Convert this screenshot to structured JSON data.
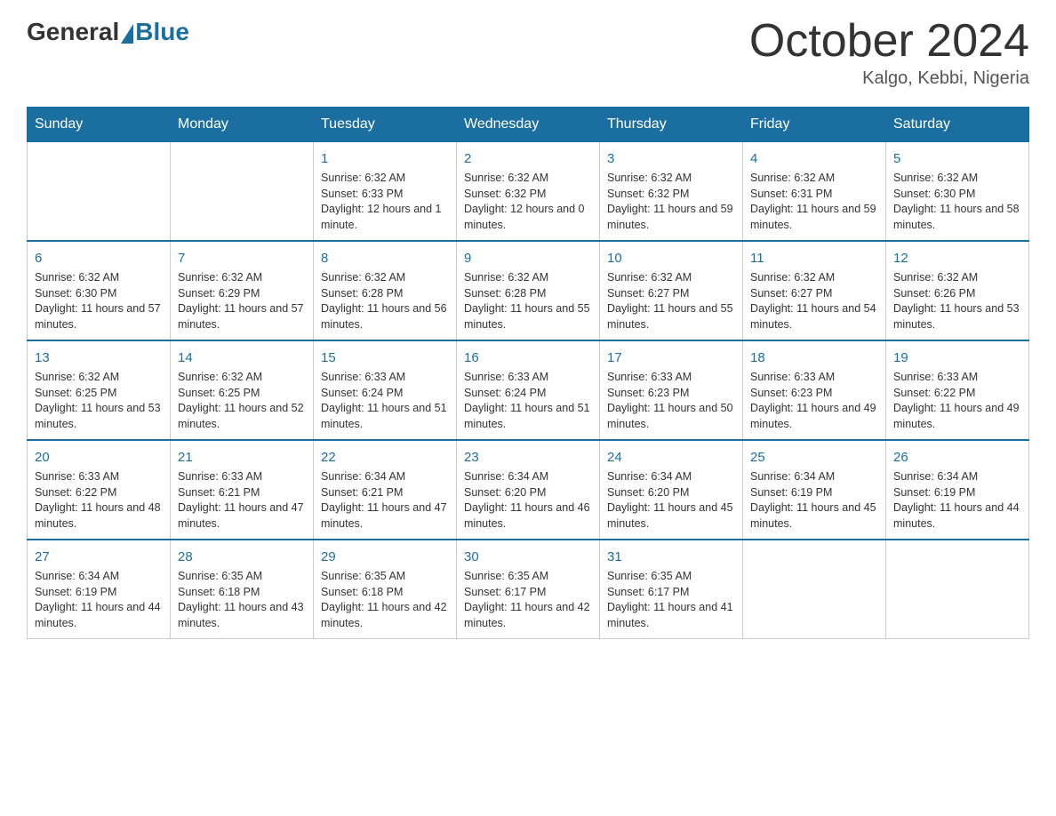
{
  "header": {
    "logo_general": "General",
    "logo_blue": "Blue",
    "month_title": "October 2024",
    "location": "Kalgo, Kebbi, Nigeria"
  },
  "weekdays": [
    "Sunday",
    "Monday",
    "Tuesday",
    "Wednesday",
    "Thursday",
    "Friday",
    "Saturday"
  ],
  "weeks": [
    [
      {
        "day": "",
        "sunrise": "",
        "sunset": "",
        "daylight": ""
      },
      {
        "day": "",
        "sunrise": "",
        "sunset": "",
        "daylight": ""
      },
      {
        "day": "1",
        "sunrise": "Sunrise: 6:32 AM",
        "sunset": "Sunset: 6:33 PM",
        "daylight": "Daylight: 12 hours and 1 minute."
      },
      {
        "day": "2",
        "sunrise": "Sunrise: 6:32 AM",
        "sunset": "Sunset: 6:32 PM",
        "daylight": "Daylight: 12 hours and 0 minutes."
      },
      {
        "day": "3",
        "sunrise": "Sunrise: 6:32 AM",
        "sunset": "Sunset: 6:32 PM",
        "daylight": "Daylight: 11 hours and 59 minutes."
      },
      {
        "day": "4",
        "sunrise": "Sunrise: 6:32 AM",
        "sunset": "Sunset: 6:31 PM",
        "daylight": "Daylight: 11 hours and 59 minutes."
      },
      {
        "day": "5",
        "sunrise": "Sunrise: 6:32 AM",
        "sunset": "Sunset: 6:30 PM",
        "daylight": "Daylight: 11 hours and 58 minutes."
      }
    ],
    [
      {
        "day": "6",
        "sunrise": "Sunrise: 6:32 AM",
        "sunset": "Sunset: 6:30 PM",
        "daylight": "Daylight: 11 hours and 57 minutes."
      },
      {
        "day": "7",
        "sunrise": "Sunrise: 6:32 AM",
        "sunset": "Sunset: 6:29 PM",
        "daylight": "Daylight: 11 hours and 57 minutes."
      },
      {
        "day": "8",
        "sunrise": "Sunrise: 6:32 AM",
        "sunset": "Sunset: 6:28 PM",
        "daylight": "Daylight: 11 hours and 56 minutes."
      },
      {
        "day": "9",
        "sunrise": "Sunrise: 6:32 AM",
        "sunset": "Sunset: 6:28 PM",
        "daylight": "Daylight: 11 hours and 55 minutes."
      },
      {
        "day": "10",
        "sunrise": "Sunrise: 6:32 AM",
        "sunset": "Sunset: 6:27 PM",
        "daylight": "Daylight: 11 hours and 55 minutes."
      },
      {
        "day": "11",
        "sunrise": "Sunrise: 6:32 AM",
        "sunset": "Sunset: 6:27 PM",
        "daylight": "Daylight: 11 hours and 54 minutes."
      },
      {
        "day": "12",
        "sunrise": "Sunrise: 6:32 AM",
        "sunset": "Sunset: 6:26 PM",
        "daylight": "Daylight: 11 hours and 53 minutes."
      }
    ],
    [
      {
        "day": "13",
        "sunrise": "Sunrise: 6:32 AM",
        "sunset": "Sunset: 6:25 PM",
        "daylight": "Daylight: 11 hours and 53 minutes."
      },
      {
        "day": "14",
        "sunrise": "Sunrise: 6:32 AM",
        "sunset": "Sunset: 6:25 PM",
        "daylight": "Daylight: 11 hours and 52 minutes."
      },
      {
        "day": "15",
        "sunrise": "Sunrise: 6:33 AM",
        "sunset": "Sunset: 6:24 PM",
        "daylight": "Daylight: 11 hours and 51 minutes."
      },
      {
        "day": "16",
        "sunrise": "Sunrise: 6:33 AM",
        "sunset": "Sunset: 6:24 PM",
        "daylight": "Daylight: 11 hours and 51 minutes."
      },
      {
        "day": "17",
        "sunrise": "Sunrise: 6:33 AM",
        "sunset": "Sunset: 6:23 PM",
        "daylight": "Daylight: 11 hours and 50 minutes."
      },
      {
        "day": "18",
        "sunrise": "Sunrise: 6:33 AM",
        "sunset": "Sunset: 6:23 PM",
        "daylight": "Daylight: 11 hours and 49 minutes."
      },
      {
        "day": "19",
        "sunrise": "Sunrise: 6:33 AM",
        "sunset": "Sunset: 6:22 PM",
        "daylight": "Daylight: 11 hours and 49 minutes."
      }
    ],
    [
      {
        "day": "20",
        "sunrise": "Sunrise: 6:33 AM",
        "sunset": "Sunset: 6:22 PM",
        "daylight": "Daylight: 11 hours and 48 minutes."
      },
      {
        "day": "21",
        "sunrise": "Sunrise: 6:33 AM",
        "sunset": "Sunset: 6:21 PM",
        "daylight": "Daylight: 11 hours and 47 minutes."
      },
      {
        "day": "22",
        "sunrise": "Sunrise: 6:34 AM",
        "sunset": "Sunset: 6:21 PM",
        "daylight": "Daylight: 11 hours and 47 minutes."
      },
      {
        "day": "23",
        "sunrise": "Sunrise: 6:34 AM",
        "sunset": "Sunset: 6:20 PM",
        "daylight": "Daylight: 11 hours and 46 minutes."
      },
      {
        "day": "24",
        "sunrise": "Sunrise: 6:34 AM",
        "sunset": "Sunset: 6:20 PM",
        "daylight": "Daylight: 11 hours and 45 minutes."
      },
      {
        "day": "25",
        "sunrise": "Sunrise: 6:34 AM",
        "sunset": "Sunset: 6:19 PM",
        "daylight": "Daylight: 11 hours and 45 minutes."
      },
      {
        "day": "26",
        "sunrise": "Sunrise: 6:34 AM",
        "sunset": "Sunset: 6:19 PM",
        "daylight": "Daylight: 11 hours and 44 minutes."
      }
    ],
    [
      {
        "day": "27",
        "sunrise": "Sunrise: 6:34 AM",
        "sunset": "Sunset: 6:19 PM",
        "daylight": "Daylight: 11 hours and 44 minutes."
      },
      {
        "day": "28",
        "sunrise": "Sunrise: 6:35 AM",
        "sunset": "Sunset: 6:18 PM",
        "daylight": "Daylight: 11 hours and 43 minutes."
      },
      {
        "day": "29",
        "sunrise": "Sunrise: 6:35 AM",
        "sunset": "Sunset: 6:18 PM",
        "daylight": "Daylight: 11 hours and 42 minutes."
      },
      {
        "day": "30",
        "sunrise": "Sunrise: 6:35 AM",
        "sunset": "Sunset: 6:17 PM",
        "daylight": "Daylight: 11 hours and 42 minutes."
      },
      {
        "day": "31",
        "sunrise": "Sunrise: 6:35 AM",
        "sunset": "Sunset: 6:17 PM",
        "daylight": "Daylight: 11 hours and 41 minutes."
      },
      {
        "day": "",
        "sunrise": "",
        "sunset": "",
        "daylight": ""
      },
      {
        "day": "",
        "sunrise": "",
        "sunset": "",
        "daylight": ""
      }
    ]
  ]
}
